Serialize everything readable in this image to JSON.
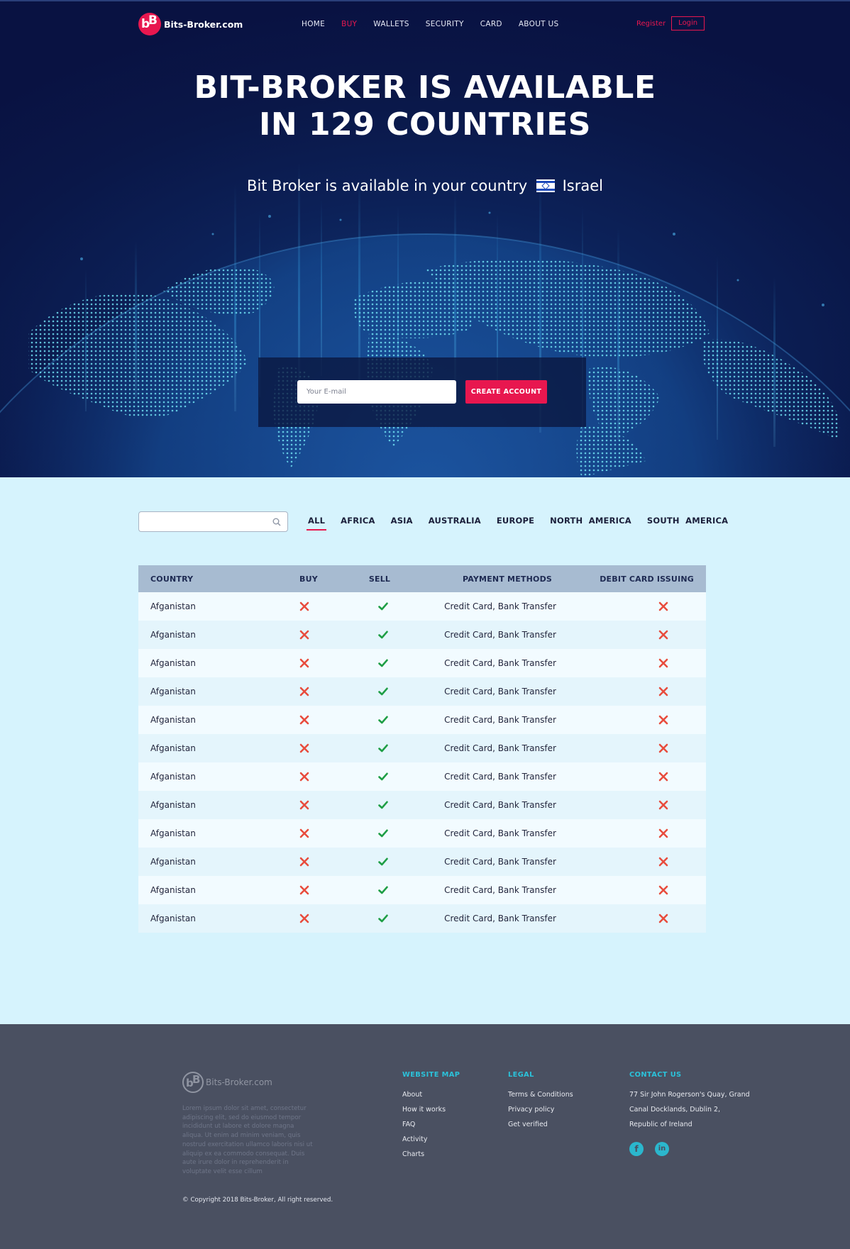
{
  "colors": {
    "accent": "#e8174f",
    "hero_bg": "#0a1748",
    "table_header": "#a7bbd1",
    "page_bg": "#d6f3fd",
    "footer_bg": "#4a5061",
    "footer_heading": "#2bc2da",
    "check": "#1e9e45",
    "cross": "#e84c3d"
  },
  "nav": {
    "logo_text": "Bits-Broker.com",
    "items": [
      {
        "label": "HOME",
        "active": false
      },
      {
        "label": "BUY",
        "active": true
      },
      {
        "label": "WALLETS",
        "active": false
      },
      {
        "label": "SECURITY",
        "active": false
      },
      {
        "label": "CARD",
        "active": false
      },
      {
        "label": "ABOUT US",
        "active": false
      }
    ],
    "register": "Register",
    "login": "Login"
  },
  "hero": {
    "title_line1": "BIT-BROKER IS AVAILABLE",
    "title_line2": "IN 129 COUNTRIES",
    "subtitle": "Bit Broker is available in your country",
    "country": "Israel",
    "email_placeholder": "Your E-mail",
    "cta": "CREATE ACCOUNT"
  },
  "filter": {
    "search_placeholder": "",
    "tabs": [
      "ALL",
      "AFRICA",
      "ASIA",
      "AUSTRALIA",
      "EUROPE",
      "NORTH  AMERICA",
      "SOUTH  AMERICA"
    ],
    "active_tab": "ALL"
  },
  "table": {
    "headers": [
      "COUNTRY",
      "BUY",
      "SELL",
      "PAYMENT METHODS",
      "DEBIT CARD ISSUING"
    ],
    "rows": [
      {
        "country": "Afganistan",
        "buy": false,
        "sell": true,
        "payment": "Credit Card, Bank Transfer",
        "debit": false
      },
      {
        "country": "Afganistan",
        "buy": false,
        "sell": true,
        "payment": "Credit Card, Bank Transfer",
        "debit": false
      },
      {
        "country": "Afganistan",
        "buy": false,
        "sell": true,
        "payment": "Credit Card, Bank Transfer",
        "debit": false
      },
      {
        "country": "Afganistan",
        "buy": false,
        "sell": true,
        "payment": "Credit Card, Bank Transfer",
        "debit": false
      },
      {
        "country": "Afganistan",
        "buy": false,
        "sell": true,
        "payment": "Credit Card, Bank Transfer",
        "debit": false
      },
      {
        "country": "Afganistan",
        "buy": false,
        "sell": true,
        "payment": "Credit Card, Bank Transfer",
        "debit": false
      },
      {
        "country": "Afganistan",
        "buy": false,
        "sell": true,
        "payment": "Credit Card, Bank Transfer",
        "debit": false
      },
      {
        "country": "Afganistan",
        "buy": false,
        "sell": true,
        "payment": "Credit Card, Bank Transfer",
        "debit": false
      },
      {
        "country": "Afganistan",
        "buy": false,
        "sell": true,
        "payment": "Credit Card, Bank Transfer",
        "debit": false
      },
      {
        "country": "Afganistan",
        "buy": false,
        "sell": true,
        "payment": "Credit Card, Bank Transfer",
        "debit": false
      },
      {
        "country": "Afganistan",
        "buy": false,
        "sell": true,
        "payment": "Credit Card, Bank Transfer",
        "debit": false
      },
      {
        "country": "Afganistan",
        "buy": false,
        "sell": true,
        "payment": "Credit Card, Bank Transfer",
        "debit": false
      }
    ]
  },
  "footer": {
    "logo_text": "Bits-Broker.com",
    "description": "Lorem ipsum dolor sit amet, consectetur adipiscing elit, sed do eiusmod tempor incididunt ut labore et dolore magna aliqua. Ut enim ad minim veniam, quis nostrud exercitation ullamco laboris nisi ut aliquip ex ea commodo consequat. Duis aute irure dolor in reprehenderit in voluptate velit esse cillum",
    "sitemap": {
      "title": "WEBSITE MAP",
      "links": [
        "About",
        "How it works",
        "FAQ",
        "Activity",
        "Charts"
      ]
    },
    "legal": {
      "title": "LEGAL",
      "links": [
        "Terms & Conditions",
        "Privacy policy",
        "Get verified"
      ]
    },
    "contact": {
      "title": "CONTACT US",
      "address_lines": [
        "77 Sir John Rogerson's Quay, Grand",
        "Canal Docklands, Dublin 2,",
        "Republic of Ireland"
      ]
    },
    "social": [
      {
        "name": "facebook-icon",
        "glyph": "f"
      },
      {
        "name": "linkedin-icon",
        "glyph": "in"
      }
    ],
    "copyright": "© Copyright 2018 Bits-Broker, All right reserved."
  }
}
